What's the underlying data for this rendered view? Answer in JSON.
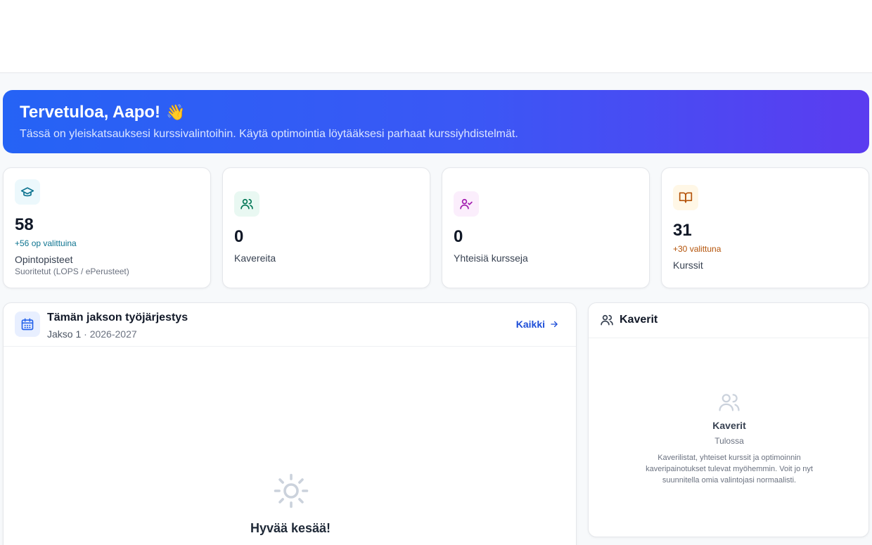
{
  "hero": {
    "title": "Tervetuloa, Aapo!",
    "emoji": "👋",
    "subtitle": "Tässä on yleiskatsauksesi kurssivalintoihin. Käytä optimointia löytääksesi parhaat kurssiyhdistelmät."
  },
  "stats": [
    {
      "icon": "graduation-cap-icon",
      "value": "58",
      "note": "+56 op valittuina",
      "label": "Opintopisteet",
      "sub": "Suoritetut (LOPS / ePerusteet)",
      "accent": "#0e7490",
      "tint": "#ecf8fc"
    },
    {
      "icon": "users-icon",
      "value": "0",
      "label": "Kavereita",
      "accent": "#047857",
      "tint": "#e9f8f2"
    },
    {
      "icon": "user-check-icon",
      "value": "0",
      "label": "Yhteisiä kursseja",
      "accent": "#a21caf",
      "tint": "#fbeefc"
    },
    {
      "icon": "book-open-icon",
      "value": "31",
      "note": "+30 valittuna",
      "label": "Kurssit",
      "accent": "#b45309",
      "tint": "#fff7e6"
    }
  ],
  "schedule": {
    "title": "Tämän jakson työjärjestys",
    "period": "Jakso 1",
    "separator": " · ",
    "year": "2026-2027",
    "link": "Kaikki",
    "empty_title": "Hyvää kesää!"
  },
  "friends": {
    "title": "Kaverit",
    "empty_title": "Kaverit",
    "status": "Tulossa",
    "description": "Kaverilistat, yhteiset kurssit ja optimoinnin kaveripainotukset tulevat myöhemmin. Voit jo nyt suunnitella omia valintojasi normaalisti."
  },
  "colors": {
    "hero_start": "#2563f5",
    "hero_end": "#5b3cf0",
    "link": "#1d4ed8"
  }
}
